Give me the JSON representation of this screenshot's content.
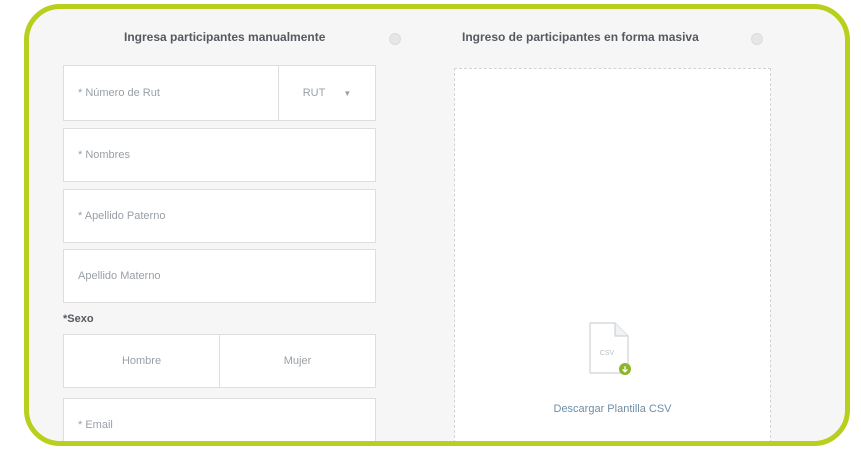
{
  "manual": {
    "title": "Ingresa participantes manualmente",
    "rut_placeholder": "* Número de Rut",
    "rut_type": "RUT",
    "nombres_placeholder": "* Nombres",
    "apellido_paterno_placeholder": "* Apellido Paterno",
    "apellido_materno_placeholder": "Apellido Materno",
    "sexo_label": "*Sexo",
    "sexo_options": [
      "Hombre",
      "Mujer"
    ],
    "email_placeholder": "* Email"
  },
  "masivo": {
    "title": "Ingreso de participantes en forma masiva",
    "csv_icon_label": "CSV",
    "download_label": "Descargar Plantilla CSV"
  },
  "colors": {
    "frame_border": "#b9cf1d",
    "background": "#f6f6f6",
    "link": "#6f8ea6",
    "badge": "#8db52b"
  }
}
